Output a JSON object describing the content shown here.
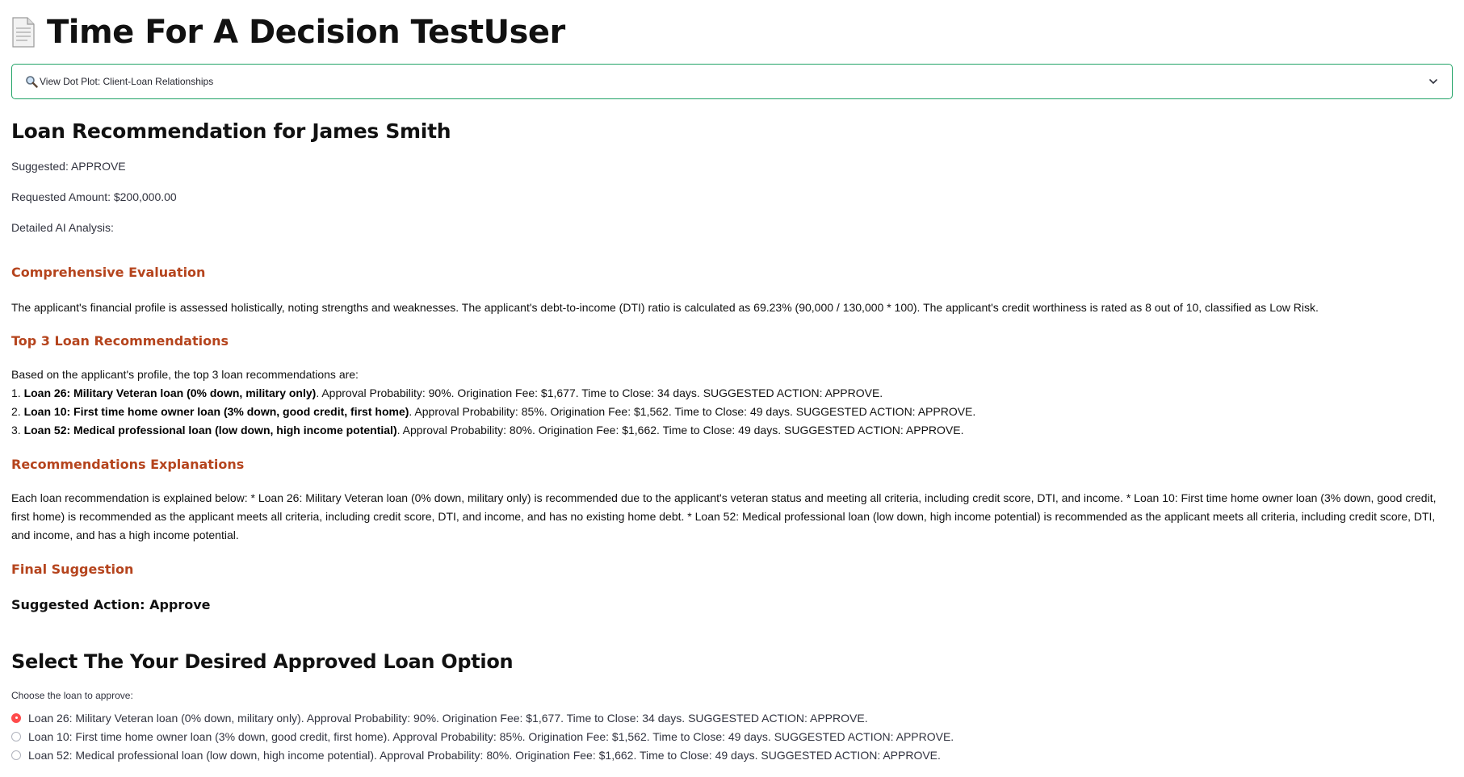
{
  "header": {
    "title": "Time For A Decision TestUser",
    "icon": "document-icon"
  },
  "expander": {
    "label": "View Dot Plot: Client-Loan Relationships",
    "icon": "magnifier-icon"
  },
  "recommendation": {
    "heading": "Loan Recommendation for James Smith",
    "suggested": "Suggested: APPROVE",
    "requested_amount": "Requested Amount: $200,000.00",
    "analysis_label": "Detailed AI Analysis:"
  },
  "analysis": {
    "evaluation_heading": "Comprehensive Evaluation",
    "evaluation_text": "The applicant's financial profile is assessed holistically, noting strengths and weaknesses. The applicant's debt-to-income (DTI) ratio is calculated as 69.23% (90,000 / 130,000 * 100). The applicant's credit worthiness is rated as 8 out of 10, classified as Low Risk.",
    "top3_heading": "Top 3 Loan Recommendations",
    "top3_intro": "Based on the applicant's profile, the top 3 loan recommendations are:",
    "top3": [
      {
        "num": "1. ",
        "name": "Loan 26: Military Veteran loan (0% down, military only)",
        "details": ". Approval Probability: 90%. Origination Fee: $1,677. Time to Close: 34 days. SUGGESTED ACTION: APPROVE."
      },
      {
        "num": "2. ",
        "name": "Loan 10: First time home owner loan (3% down, good credit, first home)",
        "details": ". Approval Probability: 85%. Origination Fee: $1,562. Time to Close: 49 days. SUGGESTED ACTION: APPROVE."
      },
      {
        "num": "3. ",
        "name": "Loan 52: Medical professional loan (low down, high income potential)",
        "details": ". Approval Probability: 80%. Origination Fee: $1,662. Time to Close: 49 days. SUGGESTED ACTION: APPROVE."
      }
    ],
    "explanations_heading": "Recommendations Explanations",
    "explanations_text": "Each loan recommendation is explained below: * Loan 26: Military Veteran loan (0% down, military only) is recommended due to the applicant's veteran status and meeting all criteria, including credit score, DTI, and income. * Loan 10: First time home owner loan (3% down, good credit, first home) is recommended as the applicant meets all criteria, including credit score, DTI, and income, and has no existing home debt. * Loan 52: Medical professional loan (low down, high income potential) is recommended as the applicant meets all criteria, including credit score, DTI, and income, and has a high income potential.",
    "final_heading": "Final Suggestion",
    "final_action": "Suggested Action: Approve"
  },
  "selection": {
    "heading": "Select The Your Desired Approved Loan Option",
    "prompt": "Choose the loan to approve:",
    "options": [
      "Loan 26: Military Veteran loan (0% down, military only). Approval Probability: 90%. Origination Fee: $1,677. Time to Close: 34 days. SUGGESTED ACTION: APPROVE.",
      "Loan 10: First time home owner loan (3% down, good credit, first home). Approval Probability: 85%. Origination Fee: $1,562. Time to Close: 49 days. SUGGESTED ACTION: APPROVE.",
      "Loan 52: Medical professional loan (low down, high income potential). Approval Probability: 80%. Origination Fee: $1,662. Time to Close: 49 days. SUGGESTED ACTION: APPROVE."
    ],
    "selected_index": 0
  },
  "colors": {
    "accent_green": "#21a366",
    "heading_orange": "#b5441d",
    "radio_red": "#ff4b4b"
  }
}
